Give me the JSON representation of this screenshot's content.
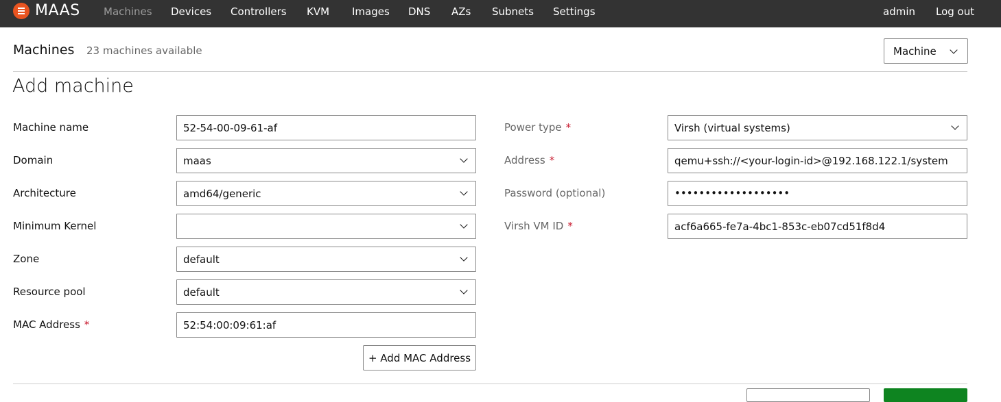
{
  "nav": {
    "brand": "MAAS",
    "links": [
      "Machines",
      "Devices",
      "Controllers",
      "KVM",
      "Images",
      "DNS",
      "AZs",
      "Subnets",
      "Settings"
    ],
    "user": "admin",
    "logout": "Log out"
  },
  "header": {
    "title": "Machines",
    "subtitle": "23 machines available",
    "type_dropdown": "Machine"
  },
  "form": {
    "title": "Add machine",
    "left": {
      "machine_name": {
        "label": "Machine name",
        "value": "52-54-00-09-61-af"
      },
      "domain": {
        "label": "Domain",
        "value": "maas"
      },
      "architecture": {
        "label": "Architecture",
        "value": "amd64/generic"
      },
      "min_kernel": {
        "label": "Minimum Kernel",
        "value": ""
      },
      "zone": {
        "label": "Zone",
        "value": "default"
      },
      "resource_pool": {
        "label": "Resource pool",
        "value": "default"
      },
      "mac_address": {
        "label": "MAC Address",
        "value": "52:54:00:09:61:af"
      },
      "add_mac": "+ Add MAC Address"
    },
    "right": {
      "power_type": {
        "label": "Power type",
        "value": "Virsh (virtual systems)"
      },
      "address": {
        "label": "Address",
        "value": "qemu+ssh://<your-login-id>@192.168.122.1/system"
      },
      "password": {
        "label": "Password (optional)",
        "value": "•••••••••••••••••••"
      },
      "vm_id": {
        "label": "Virsh VM ID",
        "value": "acf6a665-fe7a-4bc1-853c-eb07cd51f8d4"
      }
    },
    "required_marker": "*"
  },
  "colors": {
    "nav_bg": "#333333",
    "brand_orange": "#e95420",
    "required_red": "#c7162b",
    "positive_green": "#0e8420"
  }
}
